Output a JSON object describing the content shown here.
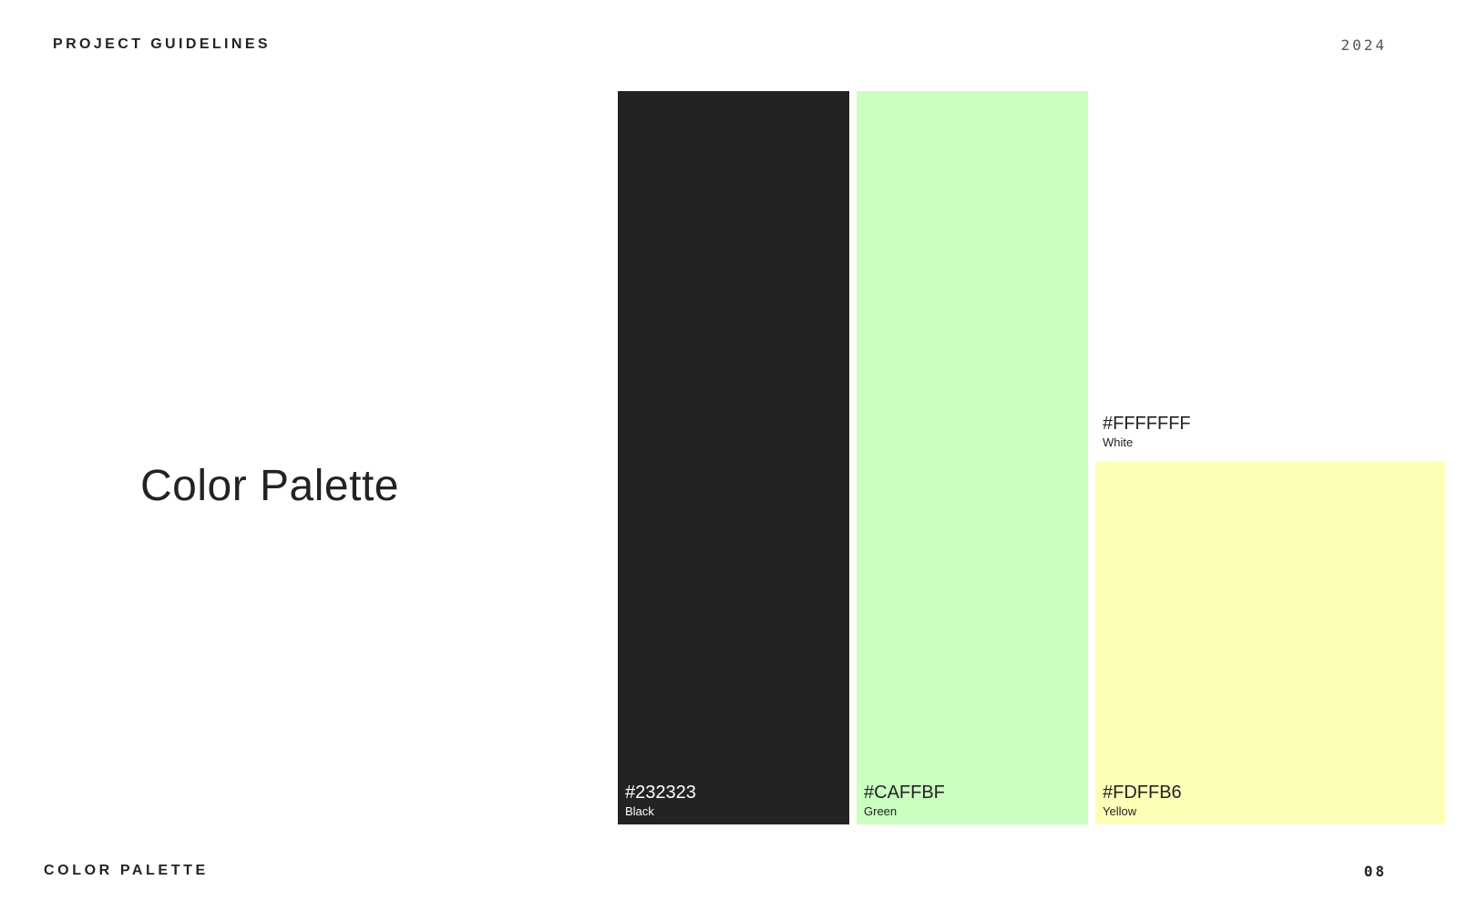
{
  "header": {
    "title": "PROJECT GUIDELINES",
    "year": "2024"
  },
  "main": {
    "title": "Color Palette"
  },
  "palette": [
    {
      "hex": "#232323",
      "name": "Black",
      "color": "#232323",
      "text_color": "#ffffff"
    },
    {
      "hex": "#CAFFBF",
      "name": "Green",
      "color": "#CAFFBF",
      "text_color": "#232323"
    },
    {
      "hex": "#FFFFFFF",
      "name": "White",
      "color": "#FFFFFF",
      "text_color": "#232323"
    },
    {
      "hex": "#FDFFB6",
      "name": "Yellow",
      "color": "#FDFFB6",
      "text_color": "#232323"
    }
  ],
  "footer": {
    "section": "COLOR PALETTE",
    "page_number": "08"
  }
}
